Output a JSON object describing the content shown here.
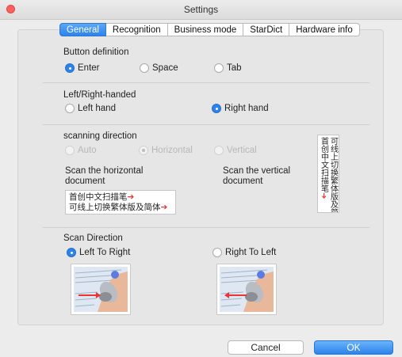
{
  "window": {
    "title": "Settings"
  },
  "tabs": [
    {
      "label": "General",
      "active": true
    },
    {
      "label": "Recognition",
      "active": false
    },
    {
      "label": "Business mode",
      "active": false
    },
    {
      "label": "StarDict",
      "active": false
    },
    {
      "label": "Hardware info",
      "active": false
    }
  ],
  "button_definition": {
    "title": "Button definition",
    "options": [
      {
        "label": "Enter",
        "selected": true
      },
      {
        "label": "Space",
        "selected": false
      },
      {
        "label": "Tab",
        "selected": false
      }
    ]
  },
  "handedness": {
    "title": "Left/Right-handed",
    "options": [
      {
        "label": "Left hand",
        "selected": false
      },
      {
        "label": "Right hand",
        "selected": true
      }
    ]
  },
  "scanning_direction": {
    "title": "scanning direction",
    "options": [
      {
        "label": "Auto",
        "selected": false,
        "enabled": false
      },
      {
        "label": "Horizontal",
        "selected": true,
        "enabled": false
      },
      {
        "label": "Vertical",
        "selected": false,
        "enabled": false
      }
    ],
    "horizontal_caption": "Scan the horizontal document",
    "vertical_caption": "Scan the vertical document",
    "horizontal_sample": {
      "line1": "首创中文扫描笔",
      "line2": "可线上切换繁体版及简体"
    },
    "vertical_sample": {
      "col1": "首创中文扫描笔",
      "col2": "可线上切换繁体版及简体"
    }
  },
  "scan_direction": {
    "title": "Scan Direction",
    "options": [
      {
        "label": "Left To Right",
        "selected": true
      },
      {
        "label": "Right To Left",
        "selected": false
      }
    ]
  },
  "footer": {
    "cancel_label": "Cancel",
    "ok_label": "OK"
  },
  "colors": {
    "accent": "#2d83ea",
    "close": "#fc605c",
    "arrow": "#e33333"
  }
}
